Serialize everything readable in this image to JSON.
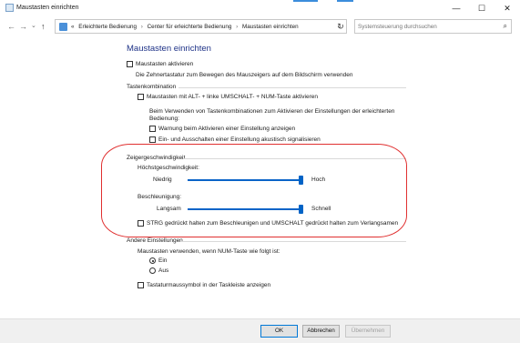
{
  "window": {
    "title": "Maustasten einrichten",
    "controls": {
      "minimize": "—",
      "maximize": "☐",
      "close": "✕"
    }
  },
  "nav": {
    "back": "←",
    "forward": "→",
    "history": "⌄",
    "up": "↑",
    "overflow": "«",
    "breadcrumb": [
      "Erleichterte Bedienung",
      "Center für erleichterte Bedienung",
      "Maustasten einrichten"
    ],
    "separator": "›",
    "dropdown": "⌄",
    "refresh": "↻",
    "search_placeholder": "Systemsteuerung durchsuchen",
    "search_icon": "⌕"
  },
  "page": {
    "title": "Maustasten einrichten",
    "enable_mousekeys": {
      "label": "Maustasten aktivieren",
      "checked": false
    },
    "enable_desc": "Die Zehnertastatur zum Bewegen des Mauszeigers auf dem Bildschirm verwenden",
    "shortcut": {
      "heading": "Tastenkombination",
      "alt_shift_numlock": {
        "label": "Maustasten mit ALT- + linke UMSCHALT- + NUM-Taste aktivieren",
        "checked": false
      },
      "desc_line1": "Beim Verwenden von Tastenkombinationen zum Aktivieren der Einstellungen der erleichterten",
      "desc_line2": "Bedienung:",
      "warning": {
        "label": "Warnung beim Aktivieren einer Einstellung anzeigen",
        "checked": false
      },
      "sound": {
        "label": "Ein- und Ausschalten einer Einstellung akustisch signalisieren",
        "checked": false
      }
    },
    "pointer_speed": {
      "heading": "Zeigergeschwindigkeit",
      "top_speed_label": "Höchstgeschwindigkeit:",
      "top_speed_min": "Niedrig",
      "top_speed_max": "Hoch",
      "top_speed_value": 1.0,
      "accel_label": "Beschleunigung:",
      "accel_min": "Langsam",
      "accel_max": "Schnell",
      "accel_value": 1.0,
      "ctrl_shift": {
        "label": "STRG gedrückt halten zum Beschleunigen und UMSCHALT gedrückt halten zum Verlangsamen",
        "checked": false
      }
    },
    "other": {
      "heading": "Andere Einstellungen",
      "numlock_desc": "Maustasten verwenden, wenn NUM-Taste wie folgt ist:",
      "on_label": "Ein",
      "off_label": "Aus",
      "selected": "Ein",
      "tray_icon": {
        "label": "Tastaturmaussymbol in der Taskleiste anzeigen",
        "checked": false
      }
    }
  },
  "buttons": {
    "ok": "OK",
    "cancel": "Abbrechen",
    "apply": "Übernehmen"
  },
  "colors": {
    "title_blue": "#1e3287",
    "accent": "#0063c6",
    "annotation": "#e03030"
  }
}
